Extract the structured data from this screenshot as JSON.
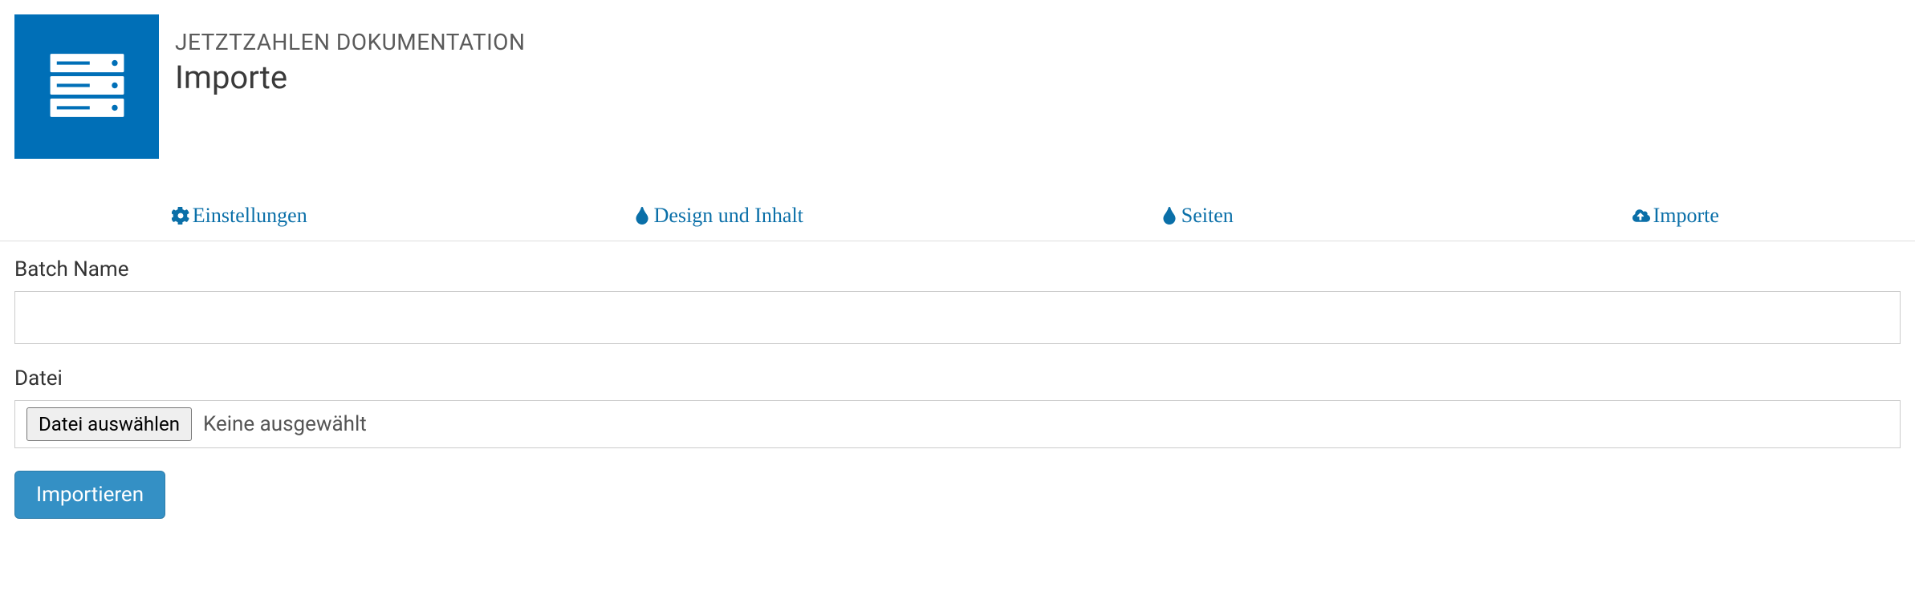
{
  "header": {
    "subtitle": "JETZTZAHLEN DOKUMENTATION",
    "title": "Importe"
  },
  "tabs": [
    {
      "label": "Einstellungen",
      "icon": "gear-icon"
    },
    {
      "label": "Design und Inhalt",
      "icon": "tint-icon"
    },
    {
      "label": "Seiten",
      "icon": "tint-icon"
    },
    {
      "label": "Importe",
      "icon": "cloud-upload-icon"
    }
  ],
  "form": {
    "batch_name_label": "Batch Name",
    "batch_name_value": "",
    "file_label": "Datei",
    "file_select_button": "Datei auswählen",
    "file_status": "Keine ausgewählt",
    "submit_label": "Importieren"
  },
  "colors": {
    "brand": "#006fb7",
    "link": "#0a6fa8",
    "button": "#3490c5"
  }
}
